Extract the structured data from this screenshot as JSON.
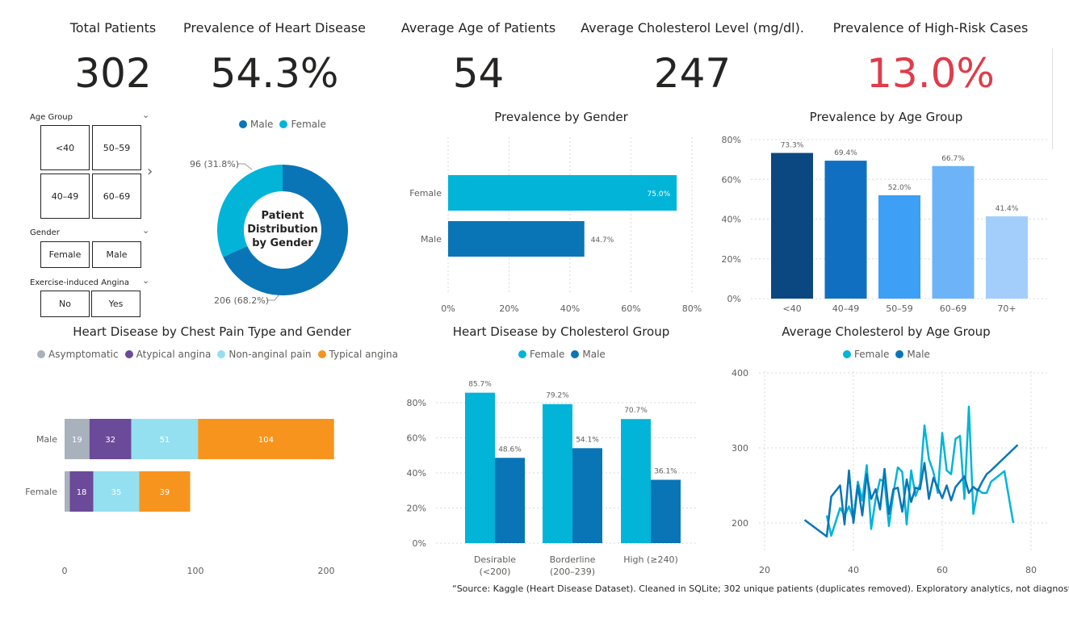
{
  "kpis": [
    {
      "title": "Total Patients",
      "value": "302",
      "color": "#252423"
    },
    {
      "title": "Prevalence of Heart Disease",
      "value": "54.3%",
      "color": "#252423"
    },
    {
      "title": "Average Age of Patients",
      "value": "54",
      "color": "#252423"
    },
    {
      "title": "Average Cholesterol Level (mg/dl).",
      "value": "247",
      "color": "#252423"
    },
    {
      "title": "Prevalence of High-Risk Cases",
      "value": "13.0%",
      "color": "#e03c4b"
    }
  ],
  "slicers": {
    "age_group": {
      "title": "Age Group",
      "options": [
        "<40",
        "50–59",
        "40–49",
        "60–69"
      ]
    },
    "gender": {
      "title": "Gender",
      "options": [
        "Female",
        "Male"
      ]
    },
    "angina": {
      "title": "Exercise-induced Angina",
      "options": [
        "No",
        "Yes"
      ]
    }
  },
  "donut": {
    "legend": [
      {
        "name": "Male",
        "color": "#0a75b6"
      },
      {
        "name": "Female",
        "color": "#01b4d8"
      }
    ],
    "center_label": [
      "Patient",
      "Distribution",
      "by Gender"
    ],
    "label_female": "96 (31.8%)",
    "label_male": "206 (68.2%)"
  },
  "gender_chart": {
    "title": "Prevalence by Gender"
  },
  "age_chart": {
    "title": "Prevalence by Age Group"
  },
  "chest_chart": {
    "title": "Heart Disease by Chest Pain Type and Gender",
    "legend": [
      {
        "name": "Asymptomatic",
        "color": "#a9b1bc"
      },
      {
        "name": "Atypical angina",
        "color": "#6b4a9a"
      },
      {
        "name": "Non-anginal pain",
        "color": "#94e0f0"
      },
      {
        "name": "Typical angina",
        "color": "#f7941e"
      }
    ]
  },
  "chol_chart": {
    "title": "Heart Disease by Cholesterol Group",
    "legend": [
      {
        "name": "Female",
        "color": "#01b4d8"
      },
      {
        "name": "Male",
        "color": "#0a75b6"
      }
    ]
  },
  "avgchol_chart": {
    "title": "Average Cholesterol by Age Group",
    "legend": [
      {
        "name": "Female",
        "color": "#01b4d8"
      },
      {
        "name": "Male",
        "color": "#0a75b6"
      }
    ]
  },
  "source_note": "“Source: Kaggle (Heart Disease Dataset). Cleaned in SQLite; 302 unique patients (duplicates removed). Exploratory analytics, not diagnostic.”",
  "chart_data": [
    {
      "type": "pie",
      "title": "Patient Distribution by Gender",
      "categories": [
        "Male",
        "Female"
      ],
      "values": [
        206,
        96
      ],
      "percent": [
        68.2,
        31.8
      ],
      "colors": [
        "#0a75b6",
        "#01b4d8"
      ]
    },
    {
      "type": "bar",
      "title": "Prevalence by Gender",
      "orientation": "horizontal",
      "categories": [
        "Female",
        "Male"
      ],
      "values": [
        75.0,
        44.7
      ],
      "data_labels": [
        "75.0%",
        "44.7%"
      ],
      "colors": [
        "#01b4d8",
        "#0a75b6"
      ],
      "xlim": [
        0,
        80
      ],
      "ticks": [
        "0%",
        "20%",
        "40%",
        "60%",
        "80%"
      ],
      "grid": true
    },
    {
      "type": "bar",
      "title": "Prevalence by Age Group",
      "categories": [
        "<40",
        "40–49",
        "50–59",
        "60–69",
        "70+"
      ],
      "values": [
        73.3,
        69.4,
        52.0,
        66.7,
        41.4
      ],
      "data_labels": [
        "73.3%",
        "69.4%",
        "52.0%",
        "66.7%",
        "41.4%"
      ],
      "colors": [
        "#0b4882",
        "#116fc1",
        "#3d9ff5",
        "#6cb4f7",
        "#a3cefc"
      ],
      "ylim": [
        0,
        80
      ],
      "ticks": [
        "0%",
        "20%",
        "40%",
        "60%",
        "80%"
      ],
      "grid": true
    },
    {
      "type": "bar",
      "title": "Heart Disease by Chest Pain Type and Gender",
      "orientation": "horizontal",
      "stacked": true,
      "categories": [
        "Male",
        "Female"
      ],
      "series": [
        {
          "name": "Asymptomatic",
          "values": [
            19,
            4
          ],
          "labels": [
            "19",
            ""
          ]
        },
        {
          "name": "Atypical angina",
          "values": [
            32,
            18
          ],
          "labels": [
            "32",
            "18"
          ]
        },
        {
          "name": "Non-anginal pain",
          "values": [
            51,
            35
          ],
          "labels": [
            "51",
            "35"
          ]
        },
        {
          "name": "Typical angina",
          "values": [
            104,
            39
          ],
          "labels": [
            "104",
            "39"
          ]
        }
      ],
      "xlim": [
        0,
        220
      ],
      "ticks": [
        "0",
        "100",
        "200"
      ]
    },
    {
      "type": "bar",
      "title": "Heart Disease by Cholesterol Group",
      "categories": [
        "Desirable (<200)",
        "Borderline (200–239)",
        "High (≥240)"
      ],
      "category_lines": [
        [
          "Desirable",
          "(<200)"
        ],
        [
          "Borderline",
          "(200–239)"
        ],
        [
          "High (≥240)"
        ]
      ],
      "series": [
        {
          "name": "Female",
          "values": [
            85.7,
            79.2,
            70.7
          ],
          "labels": [
            "85.7%",
            "79.2%",
            "70.7%"
          ]
        },
        {
          "name": "Male",
          "values": [
            48.6,
            54.1,
            36.1
          ],
          "labels": [
            "48.6%",
            "54.1%",
            "36.1%"
          ]
        }
      ],
      "ylim": [
        0,
        90
      ],
      "ticks": [
        "0%",
        "20%",
        "40%",
        "60%",
        "80%"
      ],
      "grid": true
    },
    {
      "type": "line",
      "title": "Average Cholesterol by Age Group",
      "xlim": [
        20,
        80
      ],
      "ylim": [
        180,
        400
      ],
      "xticks": [
        "20",
        "40",
        "60",
        "80"
      ],
      "yticks": [
        "200",
        "300",
        "400"
      ],
      "series": [
        {
          "name": "Female",
          "x": [
            34,
            35,
            37,
            38,
            39,
            40,
            41,
            42,
            43,
            44,
            45,
            46,
            47,
            48,
            49,
            50,
            51,
            52,
            53,
            54,
            55,
            56,
            57,
            58,
            59,
            60,
            61,
            62,
            63,
            64,
            65,
            66,
            67,
            68,
            69,
            70,
            71,
            74,
            76
          ],
          "y": [
            210,
            183,
            220,
            210,
            222,
            205,
            255,
            230,
            277,
            192,
            232,
            258,
            255,
            196,
            240,
            274,
            268,
            198,
            270,
            236,
            252,
            330,
            285,
            268,
            240,
            320,
            270,
            265,
            312,
            316,
            232,
            355,
            212,
            245,
            240,
            240,
            255,
            269,
            200
          ]
        },
        {
          "name": "Male",
          "x": [
            29,
            34,
            35,
            37,
            38,
            39,
            40,
            41,
            42,
            43,
            44,
            45,
            46,
            47,
            48,
            49,
            50,
            51,
            52,
            53,
            54,
            55,
            56,
            57,
            58,
            59,
            60,
            61,
            62,
            63,
            64,
            65,
            66,
            67,
            68,
            69,
            70,
            71,
            77
          ],
          "y": [
            204,
            182,
            235,
            250,
            198,
            270,
            200,
            250,
            210,
            265,
            232,
            245,
            218,
            272,
            212,
            245,
            247,
            215,
            258,
            228,
            247,
            245,
            280,
            232,
            260,
            247,
            233,
            250,
            230,
            248,
            255,
            262,
            240,
            248,
            243,
            255,
            265,
            270,
            304
          ]
        }
      ]
    }
  ]
}
